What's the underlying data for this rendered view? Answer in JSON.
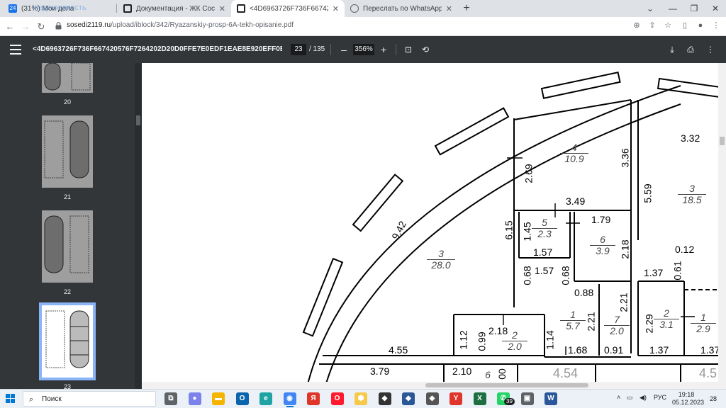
{
  "tabs": [
    {
      "label": "(31%) Мои дела",
      "badge": "24",
      "overlay": "Недвижимость",
      "favicon_color": "#1a73e8"
    },
    {
      "label": "Документация - ЖК Соседи 21...",
      "favicon_color": "#202124"
    },
    {
      "label": "<4D6963726F736F667420576F7...",
      "favicon_color": "#202124",
      "active": true
    },
    {
      "label": "Переслать по WhatsApp",
      "favicon_color": "#5f6368"
    }
  ],
  "window": {
    "new_tab": "+",
    "chevron": "⌄",
    "minimize": "—",
    "restore": "❐",
    "close": "✕"
  },
  "address": {
    "host": "sosedi2119.ru",
    "path": "/upload/iblock/342/Ryazanskiy-prosp-6A-tekh-opisanie.pdf"
  },
  "pdf": {
    "title": "<4D6963726F736F667420576F7264202D20D0FFE7E0EDF1EAE8E920EFF0EEF1EFE5...",
    "current_page": "23",
    "total_pages": "/ 135",
    "zoom": "356%",
    "zoom_out": "–",
    "zoom_in": "+"
  },
  "thumbnails": [
    {
      "page": "20"
    },
    {
      "page": "21"
    },
    {
      "page": "22"
    },
    {
      "page": "23",
      "active": true
    }
  ],
  "plan_labels": {
    "dims": [
      "9.42",
      "6.15",
      "2.69",
      "3.36",
      "3.49",
      "1.45",
      "1.57",
      "1.79",
      "2.18",
      "0.68",
      "1.57",
      "0.68",
      "0.88",
      "2.21",
      "2.21",
      "1.12",
      "0.99",
      "2.18",
      "1.14",
      "1.68",
      "0.91",
      "4.55",
      "3.79",
      "2.10",
      "5.59",
      "3.32",
      "0.12",
      "1.37",
      "0.61",
      "2.29",
      "1.37",
      "1.37",
      "00"
    ],
    "rooms": [
      {
        "num": "3",
        "area": "28.0"
      },
      {
        "num": "4",
        "area": "10.9"
      },
      {
        "num": "5",
        "area": "2.3"
      },
      {
        "num": "6",
        "area": "3.9"
      },
      {
        "num": "3",
        "area": "18.5"
      },
      {
        "num": "1",
        "area": "5.7"
      },
      {
        "num": "7",
        "area": "2.0"
      },
      {
        "num": "2",
        "area": "2.0"
      },
      {
        "num": "2",
        "area": "3.1"
      },
      {
        "num": "1",
        "area": "2.9"
      },
      {
        "num": "6",
        "area": ""
      },
      {
        "num": "4.54",
        "area": ""
      },
      {
        "num": "4.5",
        "area": ""
      }
    ]
  },
  "taskbar": {
    "search_placeholder": "Поиск",
    "apps": [
      {
        "name": "task-view",
        "color": "#5f6368",
        "glyph": "⧉"
      },
      {
        "name": "teams",
        "color": "#7b83eb",
        "glyph": "●"
      },
      {
        "name": "explorer",
        "color": "#f4b400",
        "glyph": "▬"
      },
      {
        "name": "outlook",
        "color": "#0a64ad",
        "glyph": "O"
      },
      {
        "name": "edge",
        "color": "#1fa3a3",
        "glyph": "e"
      },
      {
        "name": "chrome",
        "color": "#4285f4",
        "glyph": "◉"
      },
      {
        "name": "yandex",
        "color": "#e0352b",
        "glyph": "Я"
      },
      {
        "name": "opera",
        "color": "#ff1b2d",
        "glyph": "O"
      },
      {
        "name": "yandex-market",
        "color": "#f7c948",
        "glyph": "⬢"
      },
      {
        "name": "app-dark",
        "color": "#333333",
        "glyph": "◆"
      },
      {
        "name": "app-blue",
        "color": "#2b5797",
        "glyph": "◆"
      },
      {
        "name": "app-gray",
        "color": "#555555",
        "glyph": "◆"
      },
      {
        "name": "yandex-browser",
        "color": "#e0352b",
        "glyph": "Y"
      },
      {
        "name": "excel",
        "color": "#1d6f42",
        "glyph": "X"
      },
      {
        "name": "whatsapp",
        "color": "#25d366",
        "glyph": "✆"
      },
      {
        "name": "app-badge",
        "color": "#5f6368",
        "glyph": "▣"
      },
      {
        "name": "word",
        "color": "#2b579a",
        "glyph": "W"
      }
    ],
    "whatsapp_badge": "39",
    "lang": "РУС",
    "time": "19:18",
    "date": "05.12.2023",
    "notifications": "28"
  }
}
